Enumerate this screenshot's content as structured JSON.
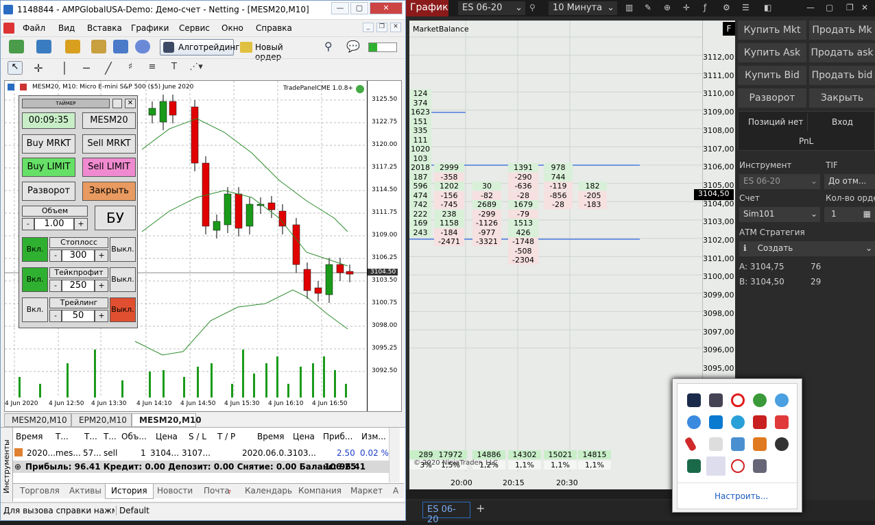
{
  "mt": {
    "title": "1148844 - AMPGlobalUSA-Demo: Демо-счет - Netting - [MESM20,M10]",
    "menu": [
      "Файл",
      "Вид",
      "Вставка",
      "Графики",
      "Сервис",
      "Окно",
      "Справка"
    ],
    "toolbar": {
      "algo": "Алготрейдинг",
      "order": "Новый ордер"
    },
    "chart": {
      "header": "MESM20, M10: Micro E-mini S&P 500 ($5) June 2020",
      "indicator": "TradePanelCME 1.0.8+",
      "prices": [
        "3125.50",
        "3122.75",
        "3120.00",
        "3117.25",
        "3114.50",
        "3111.75",
        "3109.00",
        "3106.25",
        "3103.50",
        "3100.75",
        "3098.00",
        "3095.25",
        "3092.50"
      ],
      "current": "3104.50",
      "times": [
        "4 Jun 2020",
        "4 Jun 12:50",
        "4 Jun 13:30",
        "4 Jun 14:10",
        "4 Jun 14:50",
        "4 Jun 15:30",
        "4 Jun 16:10",
        "4 Jun 16:50"
      ]
    },
    "panel": {
      "title": "ТАЙМЕР",
      "timer": "00:09:35",
      "symbol": "MESM20",
      "buy_mrkt": "Buy MRKT",
      "sell_mrkt": "Sell MRKT",
      "buy_limit": "Buy LIMIT",
      "sell_limit": "Sell LIMIT",
      "reverse": "Разворот",
      "close": "Закрыть",
      "volume_label": "Объем",
      "volume": "1.00",
      "bu": "БУ",
      "on": "Вкл.",
      "off": "Выкл.",
      "minus": "-",
      "plus": "+",
      "sl_label": "Стоплосс",
      "sl": "300",
      "tp_label": "Тейкпрофит",
      "tp": "250",
      "tr_label": "Трейлинг",
      "tr": "50"
    },
    "chart_tabs": [
      "MESM20,M10",
      "EPM20,M10",
      "MESM20,M10"
    ],
    "table": {
      "headers": [
        "Время",
        "Т...",
        "Т...",
        "Объ...",
        "Цена",
        "S / L",
        "Т / Р",
        "Время",
        "Цена",
        "Приб...",
        "Изм..."
      ],
      "row": [
        "2020...",
        "mes...",
        "57...",
        "sell",
        "1",
        "3104...",
        "3107...",
        "",
        "2020.06.0...",
        "3103...",
        "2.50",
        "0.02 %"
      ],
      "summary": "Прибыль: 96.41  Кредит: 0.00  Депозит: 0.00  Снятие: 0.00  Баланс: 96.41",
      "total": "106.25",
      "side": "Инструменты"
    },
    "bottom_tabs": [
      "Торговля",
      "Активы",
      "История",
      "Новости",
      "Почта",
      "Календарь",
      "Компания",
      "Маркет",
      "А"
    ],
    "mail_count": "7",
    "status": [
      "Для вызова справки нажмите F1",
      "Default"
    ]
  },
  "nt": {
    "tab": "График",
    "instrument": "ES 06-20",
    "interval": "10 Минута",
    "indicator": "MarketBalance",
    "f": "F",
    "prices": [
      "3112,00",
      "3111,00",
      "3110,00",
      "3109,00",
      "3108,00",
      "3107,00",
      "3106,00",
      "3105,00",
      "3104,00",
      "3103,00",
      "3102,00",
      "3101,00",
      "3100,00",
      "3099,00",
      "3098,00",
      "3097,00",
      "3096,00",
      "3095,00"
    ],
    "last": "3104,50",
    "col0": [
      "124",
      "374",
      "1623",
      "151",
      "335",
      "111",
      "1020",
      "103",
      "2018",
      "187",
      "596",
      "474",
      "742",
      "222",
      "169",
      "243"
    ],
    "col1": [
      "2999",
      "-358",
      "1202",
      "-156",
      "-745",
      "238",
      "1158",
      "-184",
      "-2471"
    ],
    "col2": [
      "30",
      "-82",
      "2689",
      "-299",
      "-1126",
      "-977",
      "-3321"
    ],
    "col3": [
      "1391",
      "-290",
      "-636",
      "-28",
      "1679",
      "-79",
      "1513",
      "426",
      "-1748",
      "-508",
      "-2304"
    ],
    "col4": [
      "978",
      "744",
      "-119",
      "-856",
      "-28"
    ],
    "col5": [
      "182",
      "-205",
      "-183"
    ],
    "totals": [
      "289",
      "17972",
      "14886",
      "14302",
      "15021",
      "14815"
    ],
    "pcts": [
      "3%",
      "1,5%",
      "1,2%",
      "1,1%",
      "1,1%",
      "1,1%"
    ],
    "copyright": "© 2020 NinjaTrader, LLC",
    "times": [
      "20:00",
      "20:15",
      "20:30"
    ],
    "buttons": [
      "Купить Mkt",
      "Продать Mk",
      "Купить Ask",
      "Продать ask",
      "Купить Bid",
      "Продать bid",
      "Разворот",
      "Закрыть"
    ],
    "position": "Позиций нет",
    "entry": "Вход",
    "pnl": "PnL",
    "instrument_label": "Инструмент",
    "tif_label": "TIF",
    "tif": "До отм...",
    "account_label": "Счет",
    "qty_label": "Кол-во ордер",
    "account": "Sim101",
    "qty": "1",
    "atm_label": "АТМ Стратегия",
    "atm": "Создать",
    "ask": "A: 3104,75",
    "ask_size": "76",
    "bid": "B: 3104,50",
    "bid_size": "29",
    "bottom_tab": "ES 06-20",
    "add": "+"
  },
  "tray": {
    "customize": "Настроить..."
  }
}
